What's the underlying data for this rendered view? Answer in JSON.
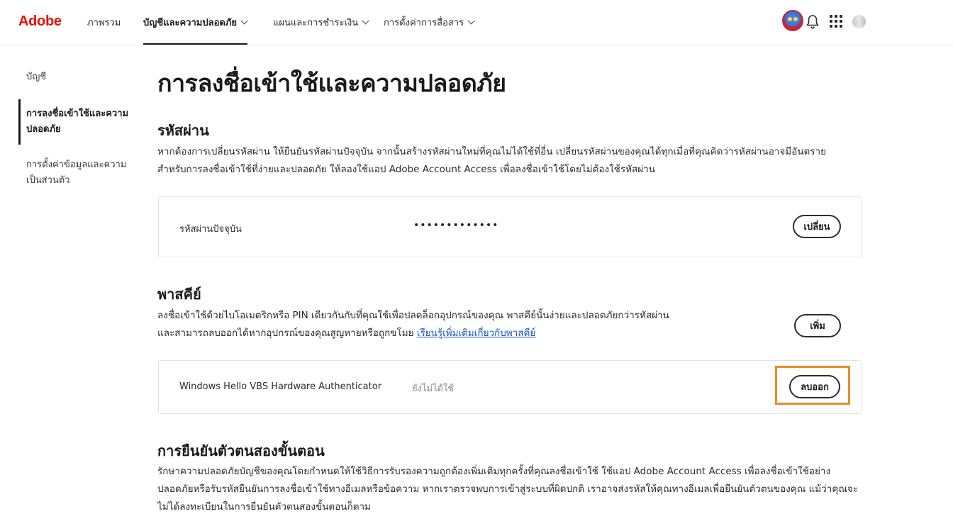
{
  "header": {
    "logo": "Adobe",
    "nav": [
      {
        "label": "ภาพรวม"
      },
      {
        "label": "บัญชีและความปลอดภัย"
      },
      {
        "label": "แผนและการชำระเงิน"
      },
      {
        "label": "การตั้งค่าการสื่อสาร"
      }
    ],
    "icons": [
      "avatar",
      "bell-icon",
      "apps-grid-icon",
      "profile-icon"
    ]
  },
  "sidebar": {
    "items": [
      {
        "label": "บัญชี"
      },
      {
        "label": "การลงชื่อเข้าใช้และความปลอดภัย"
      },
      {
        "label": "การตั้งค่าข้อมูลและความเป็นส่วนตัว"
      }
    ]
  },
  "main": {
    "title": "การลงชื่อเข้าใช้และความปลอดภัย",
    "password": {
      "heading": "รหัสผ่าน",
      "description": "หากต้องการเปลี่ยนรหัสผ่าน ให้ยืนยันรหัสผ่านปัจจุบัน จากนั้นสร้างรหัสผ่านใหม่ที่คุณไม่ได้ใช้ที่อื่น เปลี่ยนรหัสผ่านของคุณได้ทุกเมื่อที่คุณคิดว่ารหัสผ่านอาจมีอันตราย สำหรับการลงชื่อเข้าใช้ที่ง่ายและปลอดภัย ให้ลองใช้แอป Adobe Account Access เพื่อลงชื่อเข้าใช้โดยไม่ต้องใช้รหัสผ่าน",
      "current_label": "รหัสผ่านปัจจุบัน",
      "current_value": "•••••••••••••",
      "change_button": "เปลี่ยน"
    },
    "passkey": {
      "heading": "พาสคีย์",
      "description": "ลงชื่อเข้าใช้ด้วยไบโอเมตริกหรือ PIN เดียวกันกับที่คุณใช้เพื่อปลดล็อกอุปกรณ์ของคุณ พาสคีย์นั้นง่ายและปลอดภัยกว่ารหัสผ่าน และสามารถลบออกได้หากอุปกรณ์ของคุณสูญหายหรือถูกขโมย",
      "learn_more": "เรียนรู้เพิ่มเติมเกี่ยวกับพาสคีย์",
      "add_button": "เพิ่ม",
      "device_name": "Windows Hello VBS Hardware Authenticator",
      "device_status": "ยังไม่ได้ใช้",
      "remove_button": "ลบออก"
    },
    "two_step": {
      "heading": "การยืนยันตัวตนสองขั้นตอน",
      "description": "รักษาความปลอดภัยบัญชีของคุณโดยกำหนดให้ใช้วิธีการรับรองความถูกต้องเพิ่มเติมทุกครั้งที่คุณลงชื่อเข้าใช้ ใช้แอป Adobe Account Access เพื่อลงชื่อเข้าใช้อย่างปลอดภัยหรือรับรหัสยืนยันการลงชื่อเข้าใช้ทางอีเมลหรือข้อความ หากเราตรวจพบการเข้าสู่ระบบที่ผิดปกติ เราอาจส่งรหัสให้คุณทางอีเมลเพื่อยืนยันตัวตนของคุณ แม้ว่าคุณจะไม่ได้ลงทะเบียนในการยืนยันตัวตนสองขั้นตอนก็ตาม"
    }
  },
  "colors": {
    "brand": "#eb1000",
    "link": "#1452c7",
    "highlight": "#f08a24"
  }
}
